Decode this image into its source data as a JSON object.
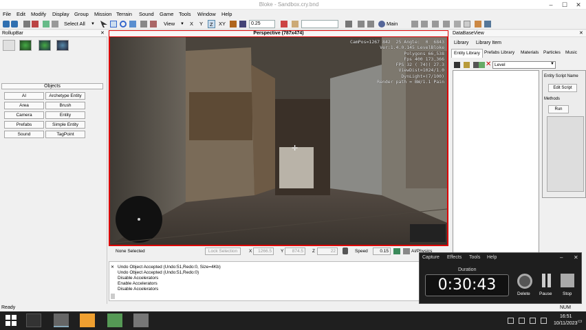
{
  "window": {
    "title": "Bloke - Sandbox.cry.bnd"
  },
  "menu": [
    "File",
    "Edit",
    "Modify",
    "Display",
    "Group",
    "Mission",
    "Terrain",
    "Sound",
    "Game",
    "Tools",
    "Window",
    "Help"
  ],
  "toolbar": {
    "select_all": "Select All",
    "view": "View",
    "axes": [
      "X",
      "Y",
      "Z",
      "XY"
    ],
    "snap_value": "0.25",
    "main": "Main"
  },
  "rollup": {
    "title": "RollupBar",
    "objects_header": "Objects",
    "buttons": [
      [
        "AI",
        "Archetype Entity"
      ],
      [
        "Area",
        "Brush"
      ],
      [
        "Camera",
        "Entity"
      ],
      [
        "Prefabs",
        "Simple Entity"
      ],
      [
        "Sound",
        "TagPoint"
      ]
    ]
  },
  "viewport": {
    "title": "Perspective (787x474)",
    "hud_lines": [
      "CamPos=1267 842  25 Angle:  0  6843",
      "Ver:1.4.0.145 LevelBloke",
      "Polygons 66,538",
      "Fps 400 173,366",
      "FPS 32 ( 74)( 27.3",
      "ViewDist=1024/1.0",
      "DynLight=(7/100)",
      "Render path = BW/1.1 Pain"
    ]
  },
  "statusrow": {
    "selection": "None Selected",
    "lock_selection": "Lock Selection",
    "x_label": "X",
    "x_value": "1266.5",
    "y_label": "Y",
    "y_value": "874.5",
    "z_label": "Z",
    "z_value": "22",
    "speed_label": "Speed",
    "speed_value": "0.15",
    "ai_physics": "AI/Physics"
  },
  "console": {
    "lines": [
      "Undo Object Accepted (Undo:51,Redo:0, Size=4Kb)",
      "Undo Object Accepted (Undo:51,Redo:0)",
      "Disable Accelerators",
      "Enable Accelerators",
      "Disable Accelerators"
    ]
  },
  "database": {
    "title": "DataBaseView",
    "menu": [
      "Library",
      "Library Item"
    ],
    "tabs": [
      "Entity Library",
      "Prefabs Library",
      "Materials",
      "Particles",
      "Music"
    ],
    "library_select": "Level",
    "panel": {
      "entity_script_name": "Entity Script Name",
      "edit_script": "Edit Script",
      "methods": "Methods",
      "run": "Run"
    }
  },
  "capture": {
    "menu": [
      "Capture",
      "Effects",
      "Tools",
      "Help"
    ],
    "duration_label": "Duration",
    "duration": "0:30:43",
    "actions": [
      "Delete",
      "Pause",
      "Stop"
    ]
  },
  "status": {
    "ready": "Ready",
    "num": "NUM"
  },
  "taskbar": {
    "time": "16:51",
    "date": "10/11/2023"
  }
}
